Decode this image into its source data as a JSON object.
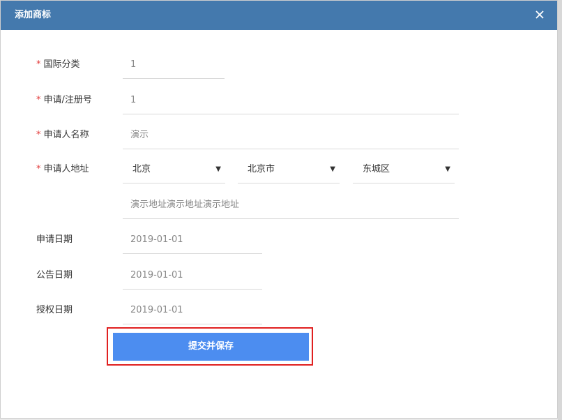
{
  "dialog": {
    "title": "添加商标",
    "close_icon": "close-icon"
  },
  "form": {
    "intl_class": {
      "label": "国际分类",
      "required": "*",
      "value": "1"
    },
    "reg_no": {
      "label": "申请/注册号",
      "required": "*",
      "value": "1"
    },
    "applicant_name": {
      "label": "申请人名称",
      "required": "*",
      "value": "演示"
    },
    "applicant_address": {
      "label": "申请人地址",
      "required": "*",
      "province": "北京",
      "city": "北京市",
      "district": "东城区",
      "detail": "演示地址演示地址演示地址"
    },
    "apply_date": {
      "label": "申请日期",
      "value": "2019-01-01"
    },
    "publish_date": {
      "label": "公告日期",
      "value": "2019-01-01"
    },
    "grant_date": {
      "label": "授权日期",
      "value": "2019-01-01"
    },
    "dropdown_arrow": "▼"
  },
  "actions": {
    "submit_label": "提交并保存"
  },
  "colors": {
    "header": "#4479ad",
    "button": "#4c8df0",
    "required": "#e23b3b",
    "highlight": "#e02020"
  }
}
